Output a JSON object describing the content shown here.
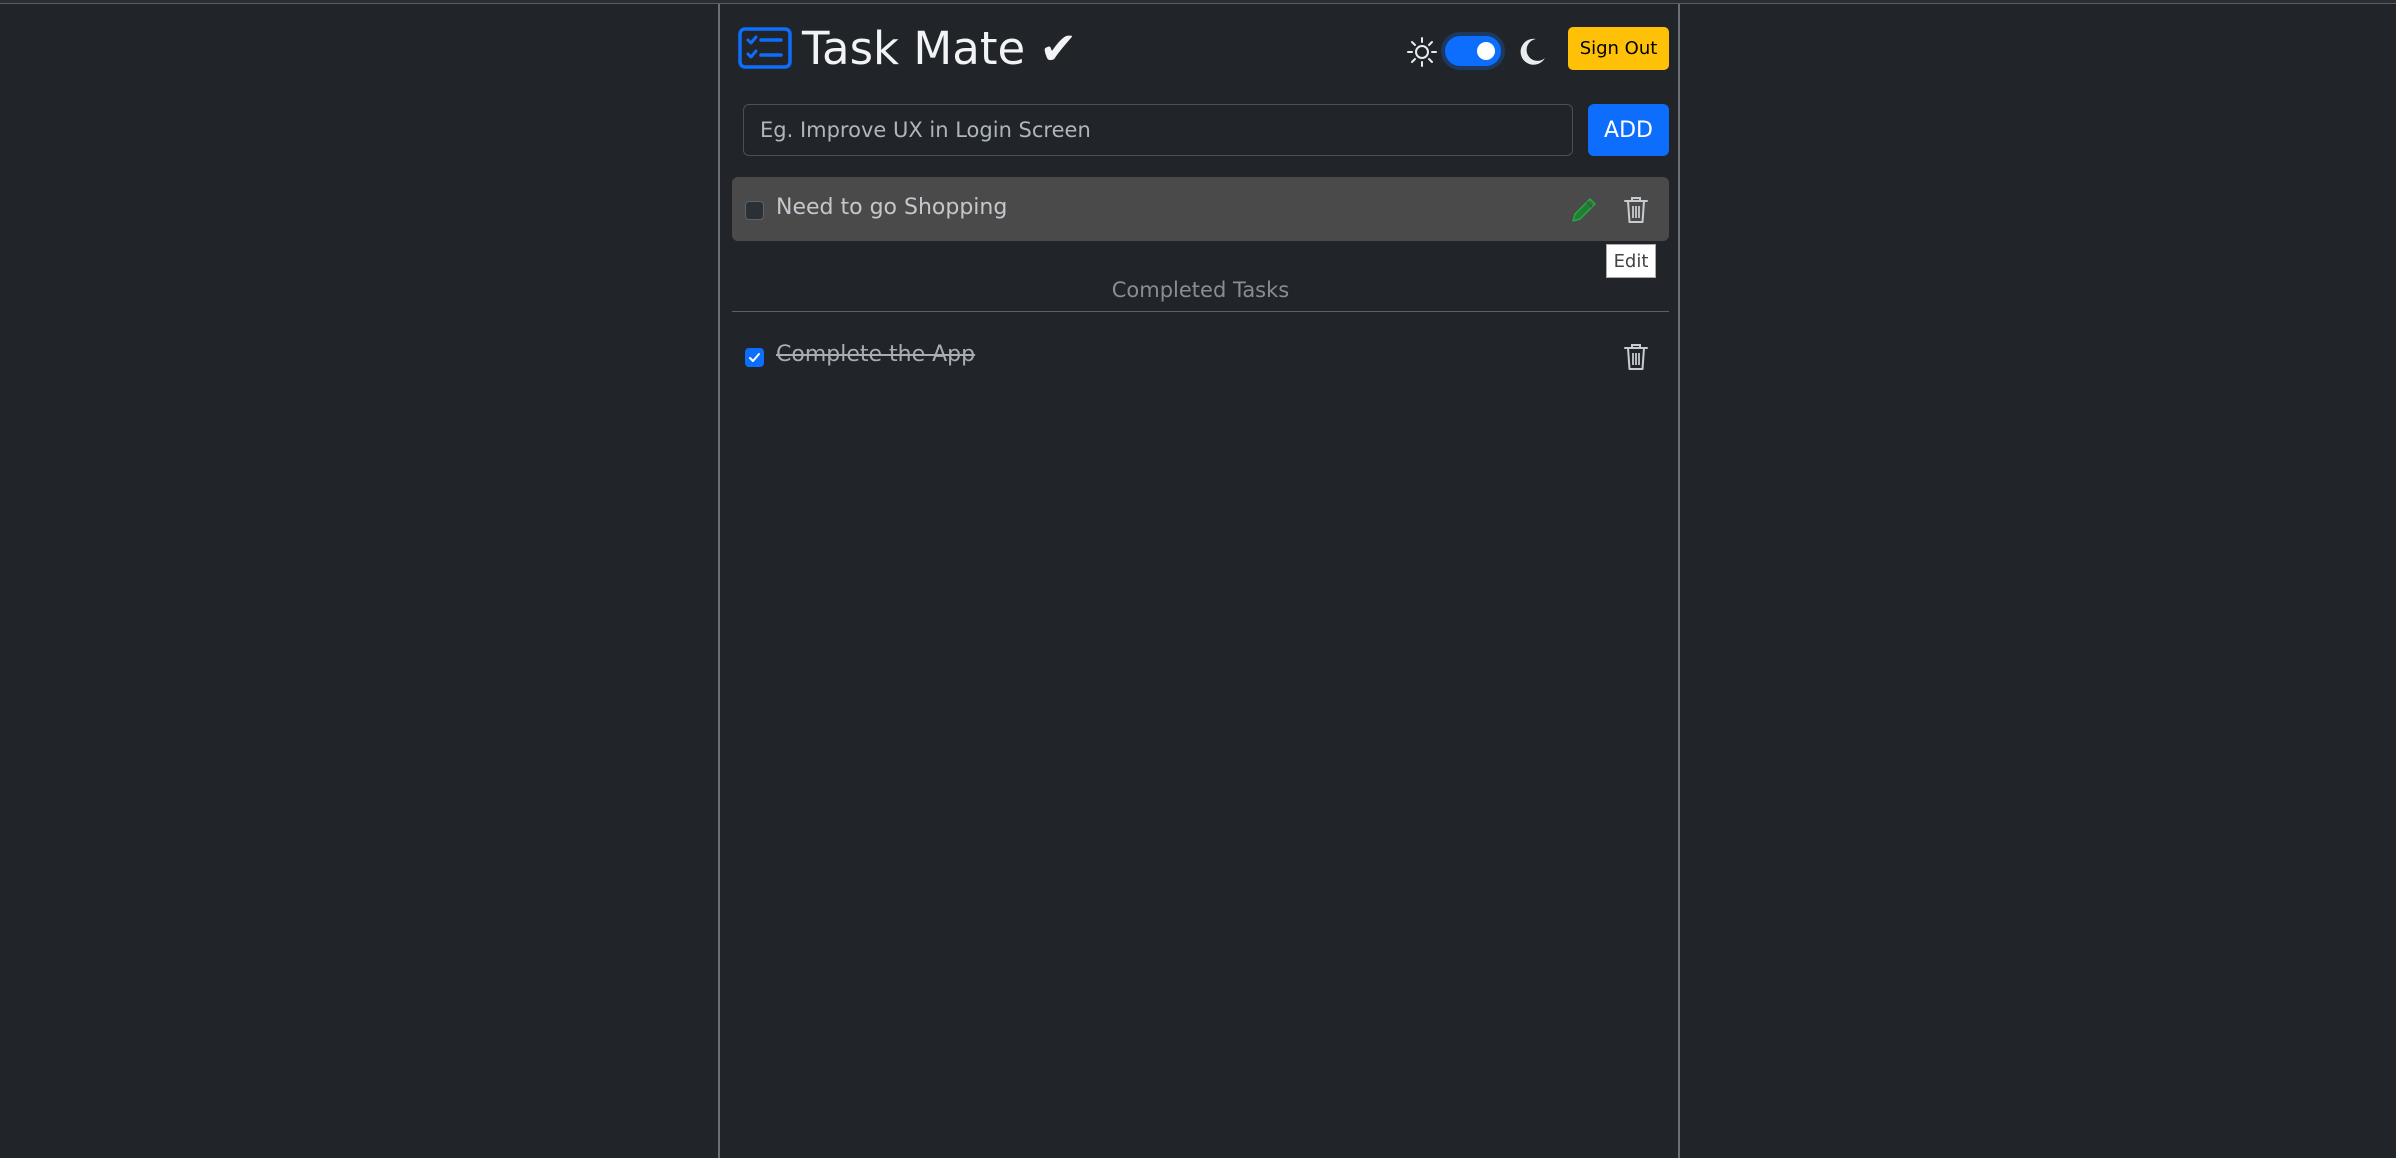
{
  "app": {
    "title": "Task Mate ✔",
    "theme_toggle_on": true,
    "signout_label": "Sign Out",
    "accent_color": "#0d6efd",
    "warning_color": "#ffc107",
    "background_color": "#212529"
  },
  "input": {
    "placeholder": "Eg. Improve UX in Login Screen",
    "value": "",
    "add_label": "ADD"
  },
  "tasks": [
    {
      "text": "Need to go Shopping",
      "completed": false
    }
  ],
  "tooltip": {
    "text": "Edit"
  },
  "completed_section": {
    "title": "Completed Tasks",
    "items": [
      {
        "text": "Complete the App",
        "completed": true
      }
    ]
  },
  "icons": {
    "brand": "checklist-icon",
    "sun": "sun-icon",
    "moon": "moon-icon",
    "edit": "pencil-icon",
    "delete": "trash-icon"
  }
}
